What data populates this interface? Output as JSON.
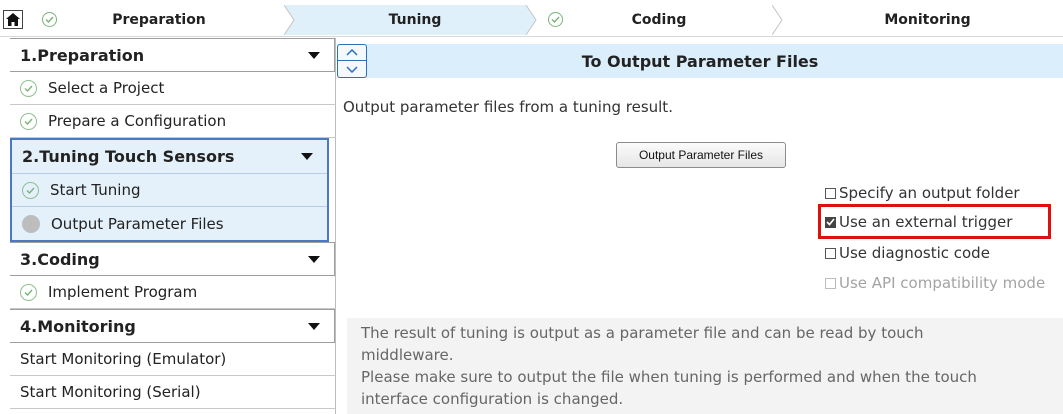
{
  "steps": [
    {
      "label": "Preparation",
      "done": true
    },
    {
      "label": "Tuning",
      "done": false,
      "active": true
    },
    {
      "label": "Coding",
      "done": true
    },
    {
      "label": "Monitoring",
      "done": false
    }
  ],
  "nav": {
    "groups": [
      {
        "title": "1.Preparation",
        "items": [
          {
            "label": "Select a Project",
            "state": "done"
          },
          {
            "label": "Prepare a Configuration",
            "state": "done"
          }
        ]
      },
      {
        "title": "2.Tuning Touch Sensors",
        "items": [
          {
            "label": "Start Tuning",
            "state": "done"
          },
          {
            "label": "Output Parameter Files",
            "state": "current"
          }
        ]
      },
      {
        "title": "3.Coding",
        "items": [
          {
            "label": "Implement Program",
            "state": "done"
          }
        ]
      },
      {
        "title": "4.Monitoring",
        "items": [
          {
            "label": "Start Monitoring (Emulator)",
            "state": "plain"
          },
          {
            "label": "Start Monitoring (Serial)",
            "state": "plain"
          }
        ]
      }
    ]
  },
  "main": {
    "title": "To Output Parameter Files",
    "description": "Output parameter files from a tuning result.",
    "button_label": "Output Parameter Files",
    "options": [
      {
        "label": "Specify an output folder",
        "checked": false,
        "disabled": false
      },
      {
        "label": "Use an external trigger",
        "checked": true,
        "disabled": false
      },
      {
        "label": "Use diagnostic code",
        "checked": false,
        "disabled": false
      },
      {
        "label": "Use API compatibility mode",
        "checked": false,
        "disabled": true
      }
    ],
    "info_lines": [
      "The result of tuning is output as a parameter file and can be read by touch",
      "middleware.",
      "Please make sure to output the file when tuning is performed and when the touch",
      "interface configuration is changed."
    ]
  },
  "colors": {
    "active_step_bg": "#dff0fb",
    "nav_active_border": "#4a78c2",
    "highlight_border": "#e01010",
    "check_green": "#7ab37a"
  },
  "icons": {
    "home": "home-icon",
    "done": "check-circle-icon",
    "current": "filled-circle-icon",
    "collapse": "caret-down-icon"
  }
}
